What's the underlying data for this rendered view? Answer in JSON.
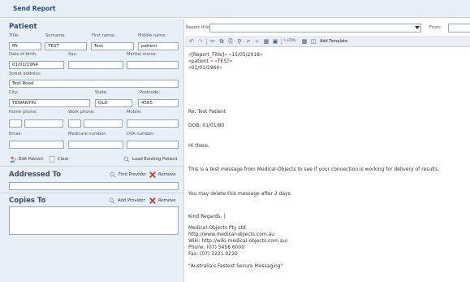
{
  "window": {
    "title": "Send Report"
  },
  "patient": {
    "heading": "Patient",
    "labels": {
      "title": "Title:",
      "surname": "Surname:",
      "first_name": "First name:",
      "middle_name": "Middle name:",
      "dob": "Date of birth:",
      "sex": "Sex:",
      "marital": "Marital status:",
      "street": "Street address:",
      "city": "City:",
      "state": "State:",
      "postcode": "Postcode:",
      "home_phone": "Home phone:",
      "work_phone": "Work phone:",
      "mobile": "Mobile:",
      "email": "Email:",
      "medicare": "Medicare number:",
      "dva": "DVA number:"
    },
    "values": {
      "title": "Mr",
      "surname": "TEST",
      "first_name": "Test",
      "middle_name": "patient",
      "dob": "01/01/1964",
      "sex": "",
      "marital": "",
      "street": "Test Road",
      "city": "TEWANTIN",
      "state": "QLD",
      "postcode": "4565",
      "home_phone_1": "",
      "home_phone_2": "",
      "work_phone_1": "",
      "work_phone_2": "",
      "mobile": "",
      "email": "",
      "medicare": "",
      "dva": ""
    },
    "actions": {
      "edit": "Edit Patient",
      "clear": "Clear",
      "load": "Load Existing Patient"
    }
  },
  "addressed_to": {
    "heading": "Addressed To",
    "find": "Find Provider",
    "remove": "Remove",
    "value": ""
  },
  "copies_to": {
    "heading": "Copies To",
    "add": "Add Provider",
    "remove": "Remove"
  },
  "report": {
    "title_label": "Report title:",
    "title_value": "",
    "from_label": "From:",
    "from_value": "",
    "add_template": "Add Template",
    "html_label": "HTML"
  },
  "document": {
    "line1_open": "«",
    "line1_field": "[Report_Title]",
    "line1_mid": "» «",
    "line1_date": "15/05/2018",
    "line1_close": "»",
    "line2_open": "«",
    "line2_field": "patient",
    "line2_mid": " » «",
    "line2_test": "TEST",
    "line2_close": "»",
    "line3_open": "«",
    "line3_field": "01/01/1964",
    "line3_close": "»",
    "re": "Re: Test Patient",
    "dob": "DOB: 01/01/80",
    "greeting": "Hi there,",
    "body1": "This is a test message from Medical-Objects to see if your connection is working for delivery of results.",
    "body2": "You may delete this message after 2 days.",
    "regards": "Kind Regards, |",
    "company": "Medical-Objects Pty Ltd",
    "url": "http://www.medical-objects.com.au",
    "wiki": "Wiki: http://wiki.medical-objects.com.au/",
    "phone": "Phone: (07) 5456 6000",
    "fax": "Fax: (07) 3221 0220",
    "tagline": "\"Australia's Fastest Secure Messaging\""
  },
  "colors": {
    "accent": "#1f4f8b",
    "pane": "#e9eff7",
    "remove": "#d9342b"
  }
}
